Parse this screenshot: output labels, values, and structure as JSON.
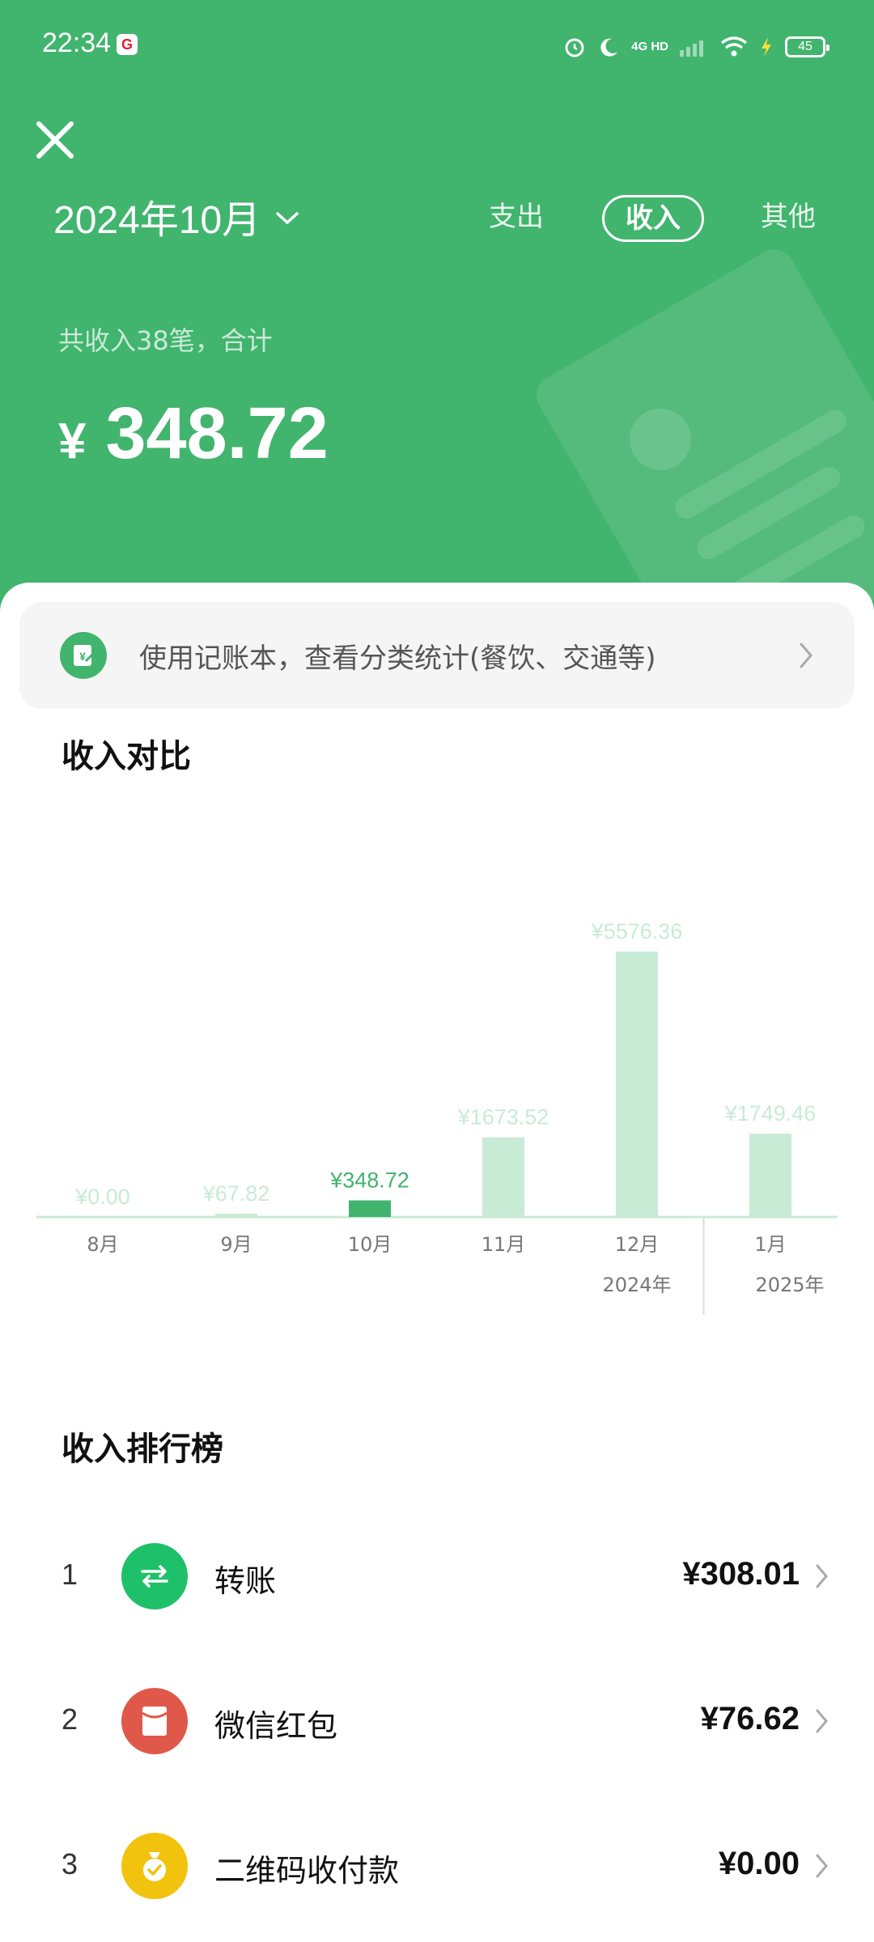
{
  "status_bar": {
    "time": "22:34",
    "network": "4G HD",
    "battery": "45",
    "icons": [
      "alarm-icon",
      "moon-icon",
      "signal-icon",
      "wifi-icon",
      "charging-icon"
    ]
  },
  "header": {
    "month_label": "2024年10月",
    "tabs": [
      {
        "label": "支出",
        "active": false
      },
      {
        "label": "收入",
        "active": true
      },
      {
        "label": "其他",
        "active": false
      }
    ],
    "summary_label": "共收入38笔，合计",
    "currency_symbol": "¥",
    "total_amount": "348.72",
    "bg_color": "#41b46e"
  },
  "ledger_banner": {
    "text": "使用记账本，查看分类统计(餐饮、交通等)",
    "icon": "ledger-book-icon"
  },
  "comparison": {
    "title": "收入对比"
  },
  "chart_data": {
    "type": "bar",
    "categories": [
      "8月",
      "9月",
      "10月",
      "11月",
      "12月",
      "1月"
    ],
    "values": [
      0.0,
      67.82,
      348.72,
      1673.52,
      5576.36,
      1749.46
    ],
    "value_labels": [
      "¥0.00",
      "¥67.82",
      "¥348.72",
      "¥1673.52",
      "¥5576.36",
      "¥1749.46"
    ],
    "selected_index": 2,
    "year_labels": [
      {
        "label": "2024年",
        "category_index": 4
      },
      {
        "label": "2025年",
        "category_index": 5
      }
    ],
    "colors": {
      "selected": "#41b46e",
      "other": "#c8ebd5",
      "selected_label": "#41b46e",
      "other_label": "#c8ebd5"
    },
    "title": "",
    "xlabel": "",
    "ylabel": ""
  },
  "ranking": {
    "title": "收入排行榜",
    "items": [
      {
        "rank": "1",
        "name": "转账",
        "amount": "¥308.01",
        "icon": "transfer-icon",
        "color": "#1fc06a"
      },
      {
        "rank": "2",
        "name": "微信红包",
        "amount": "¥76.62",
        "icon": "red-packet-icon",
        "color": "#e0584a"
      },
      {
        "rank": "3",
        "name": "二维码收付款",
        "amount": "¥0.00",
        "icon": "money-bag-icon",
        "color": "#f1c30e"
      }
    ]
  }
}
